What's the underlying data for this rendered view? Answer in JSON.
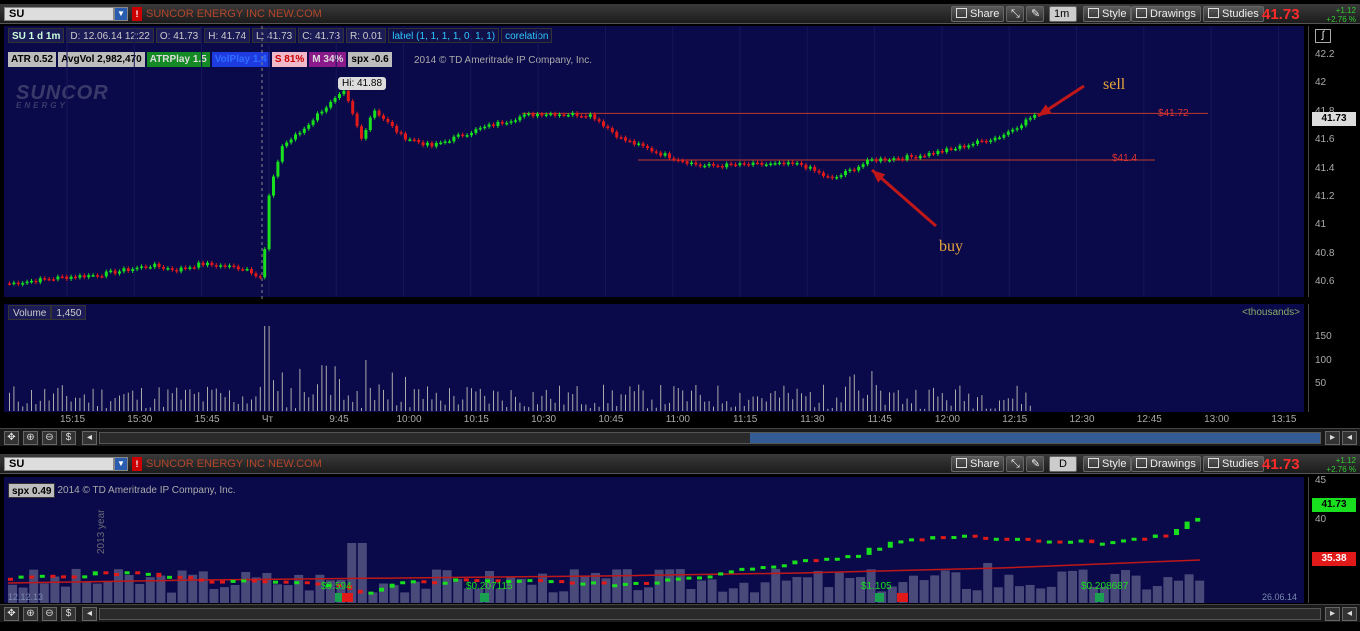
{
  "top": {
    "symbol": "SU",
    "company": "SUNCOR ENERGY INC NEW.COM",
    "alert_icon": "!",
    "share": "Share",
    "timeframe": "1m",
    "style": "Style",
    "drawings": "Drawings",
    "studies": "Studies",
    "last_price": "41.73",
    "change_abs": "+1.12",
    "change_pct": "+2.76 %",
    "info": {
      "desc": "SU 1 d 1m",
      "date": "D: 12.06.14 12:22",
      "open": "O: 41.73",
      "high": "H: 41.74",
      "low": "L: 41.73",
      "close": "C: 41.73",
      "range": "R: 0.01",
      "label": "label (1, 1, 1, 1, 0, 1, 1)",
      "corel": "corelation"
    },
    "indicators": [
      {
        "text": "ATR 0.52",
        "bg": "#bdbdbd",
        "fg": "#000"
      },
      {
        "text": "AvgVol 2,982,470",
        "bg": "#bdbdbd",
        "fg": "#000"
      },
      {
        "text": "ATRPlay 1.5",
        "bg": "#138a23",
        "fg": "#ddd"
      },
      {
        "text": "VolPlay 1.4",
        "bg": "#1e3be0",
        "fg": "#2f6cff"
      },
      {
        "text": "S 81%",
        "bg": "#f0b8c8",
        "fg": "#c00"
      },
      {
        "text": "M 34%",
        "bg": "#8a1a8a",
        "fg": "#ddd"
      },
      {
        "text": "spx -0.6",
        "bg": "#bdbdbd",
        "fg": "#000"
      }
    ],
    "copyright": "2014 © TD Ameritrade IP Company, Inc.",
    "logo": "SUNCOR",
    "logo_sub": "ENERGY",
    "hi_label": "Hi: 41.88",
    "level_sell_label": "$41.72",
    "level_buy_label": "$41.4",
    "anno_sell": "sell",
    "anno_buy": "buy",
    "price_ticks": [
      "42.2",
      "42",
      "41.8",
      "41.6",
      "41.4",
      "41.2",
      "41",
      "40.8",
      "40.6"
    ],
    "volume_label": "Volume",
    "volume_value": "1,450",
    "thousands": "<thousands>",
    "vol_ticks": [
      "150",
      "100",
      "50"
    ],
    "time_ticks": [
      "15:15",
      "15:30",
      "15:45",
      "Чт",
      "9:45",
      "10:00",
      "10:15",
      "10:30",
      "10:45",
      "11:00",
      "11:15",
      "11:30",
      "11:45",
      "12:00",
      "12:15",
      "12:30",
      "12:45",
      "13:00",
      "13:15"
    ]
  },
  "bottom": {
    "symbol": "SU",
    "company": "SUNCOR ENERGY INC NEW.COM",
    "share": "Share",
    "timeframe": "D",
    "style": "Style",
    "drawings": "Drawings",
    "studies": "Studies",
    "last_price": "41.73",
    "change_abs": "+1.12",
    "change_pct": "+2.76 %",
    "spx": "spx 0.49",
    "copyright": "2014 © TD Ameritrade IP Company, Inc.",
    "price_ticks": [
      "45",
      "40"
    ],
    "price_tag": "41.73",
    "ma_tag": "35.38",
    "start_date": "12.12.13",
    "end_date": "26.06.14",
    "year_label": "2013 year",
    "dividends": [
      "$0.594",
      "$0.207115",
      "$1.105",
      "$0.208687"
    ]
  },
  "colors": {
    "up": "#19e01e",
    "down": "#e01919",
    "level": "#c0392b",
    "bg": "#0a0a4a",
    "accent": "#ff2a2a"
  },
  "icons": [
    "share-icon",
    "cursor-icon",
    "wrench-icon",
    "style-icon",
    "drawings-icon",
    "studies-icon",
    "zoom-in-icon",
    "zoom-out-icon",
    "drag-icon",
    "dollar-icon",
    "scroll-left-icon",
    "scroll-right-icon"
  ]
}
